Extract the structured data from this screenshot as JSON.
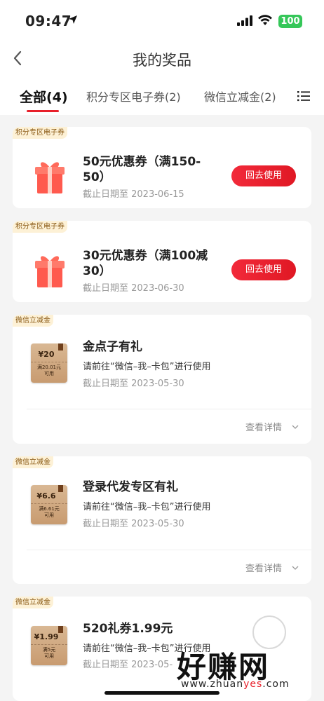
{
  "status": {
    "time": "09:47",
    "battery": "100"
  },
  "nav": {
    "title": "我的奖品"
  },
  "tabs": [
    {
      "label": "全部(4)"
    },
    {
      "label": "积分专区电子券(2)"
    },
    {
      "label": "微信立减金(2)"
    }
  ],
  "cards": [
    {
      "tag": "积分专区电子券",
      "title": "50元优惠券（满150-50）",
      "date": "截止日期至 2023-06-15",
      "button": "回去使用"
    },
    {
      "tag": "积分专区电子券",
      "title": "30元优惠券（满100减30）",
      "date": "截止日期至 2023-06-30",
      "button": "回去使用"
    },
    {
      "tag": "微信立减金",
      "title": "金点子有礼",
      "desc": "请前往“微信–我–卡包”进行使用",
      "date": "截止日期至 2023-05-30",
      "detail": "查看详情",
      "coupon_amount": "¥20",
      "coupon_cond_1": "满20.01元",
      "coupon_cond_2": "可用"
    },
    {
      "tag": "微信立减金",
      "title": "登录代发专区有礼",
      "desc": "请前往“微信–我–卡包”进行使用",
      "date": "截止日期至 2023-05-30",
      "detail": "查看详情",
      "coupon_amount": "¥6.6",
      "coupon_cond_1": "满6.61元",
      "coupon_cond_2": "可用"
    },
    {
      "tag": "微信立减金",
      "title": "520礼券1.99元",
      "desc": "请前往“微信–我–卡包”进行使用",
      "date": "截止日期至 2023-05-",
      "coupon_amount": "¥1.99",
      "coupon_cond_1": "满5元",
      "coupon_cond_2": "可用"
    }
  ],
  "watermark": {
    "text": "好赚网",
    "url_a": "www.zhuan",
    "url_b": "yes",
    "url_c": ".com"
  },
  "colors": {
    "accent": "#e8202b",
    "tag_bg": "#fdf1d6",
    "tag_text": "#8a5a15"
  }
}
